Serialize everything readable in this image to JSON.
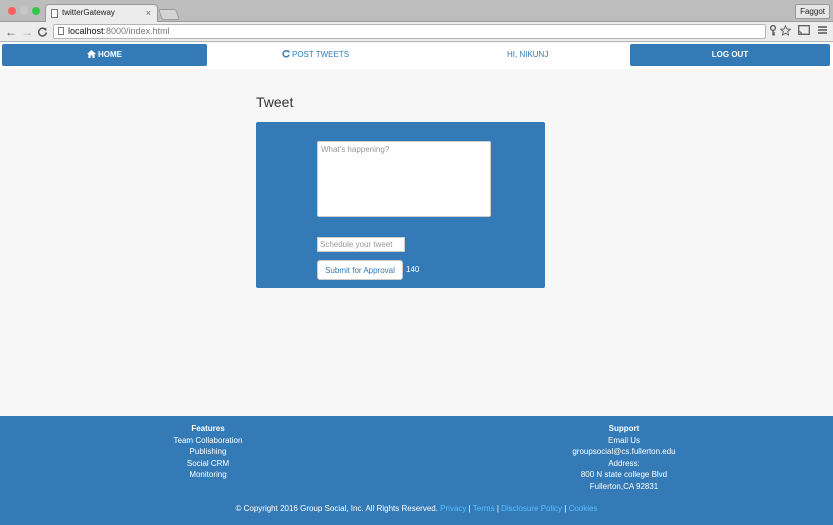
{
  "browser": {
    "tab_title": "twitterGateway",
    "tab_close": "×",
    "profile_name": "Faggot",
    "url_host": "localhost",
    "url_path": ":8000/index.html",
    "back_glyph": "←",
    "forward_glyph": "→",
    "reload_glyph": "C"
  },
  "nav": {
    "home": "HOME",
    "post_tweets": "POST TWEETS",
    "greeting": "HI, NIKUNJ",
    "logout": "LOG OUT"
  },
  "tweet": {
    "title": "Tweet",
    "textarea_placeholder": "What's happening?",
    "schedule_placeholder": "Schedule your tweet",
    "submit_label": "Submit for Approval",
    "char_count": "140"
  },
  "footer": {
    "features": {
      "heading": "Features",
      "items": [
        "Team Collaboration",
        "Publishing",
        "Social CRM",
        "Monitoring"
      ]
    },
    "support": {
      "heading": "Support",
      "lines": [
        "Email Us",
        "groupsocial@cs.fullerton.edu",
        "Address:",
        "800 N state college Blvd",
        "Fullerton,CA 92831"
      ]
    },
    "copyright": "© Copyright 2016 Group Social, Inc. All Rights Reserved.",
    "links": [
      "Privacy",
      "Terms",
      "Disclosure Policy",
      "Cookies"
    ],
    "separator": "|"
  },
  "colors": {
    "primary": "#337ab7",
    "link_light": "#5bc0ff",
    "page_bg": "#f7f7f7"
  },
  "icons": [
    "home-icon",
    "refresh-icon",
    "key-icon",
    "star-icon",
    "cast-icon",
    "menu-icon"
  ]
}
